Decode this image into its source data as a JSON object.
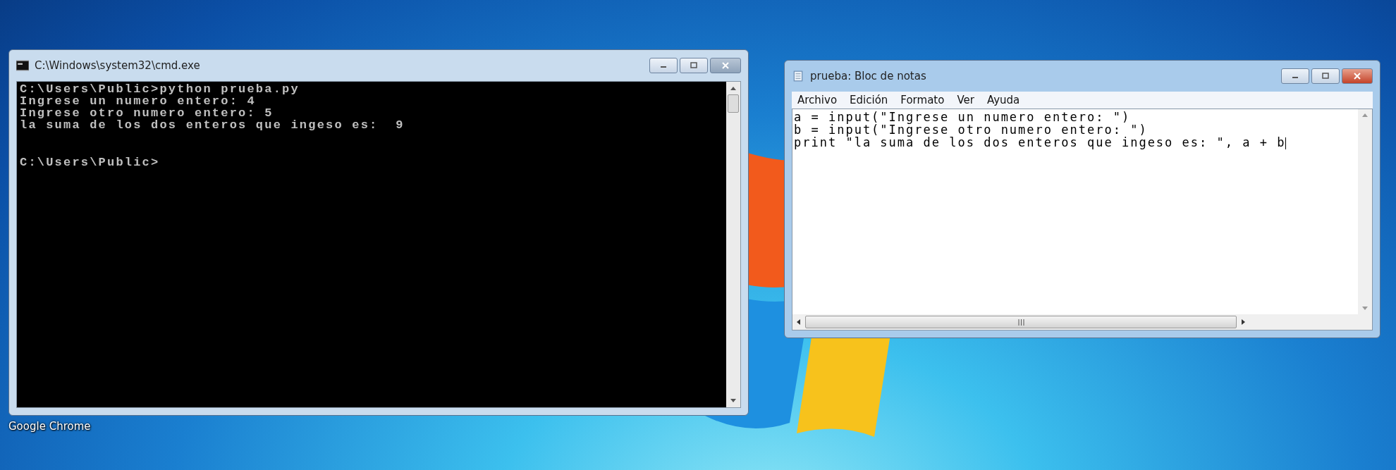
{
  "desktop": {
    "icons": [
      {
        "label": "Google Chrome"
      }
    ]
  },
  "console_window": {
    "title": "C:\\Windows\\system32\\cmd.exe",
    "active": false,
    "lines": [
      "C:\\Users\\Public>python prueba.py",
      "Ingrese un numero entero: 4",
      "Ingrese otro numero entero: 5",
      "la suma de los dos enteros que ingeso es:  9"
    ],
    "prompt": "C:\\Users\\Public>"
  },
  "notepad_window": {
    "title": "prueba: Bloc de notas",
    "active": true,
    "menu": [
      "Archivo",
      "Edición",
      "Formato",
      "Ver",
      "Ayuda"
    ],
    "lines": [
      "a = input(\"Ingrese un numero entero: \")",
      "b = input(\"Ingrese otro numero entero: \")",
      "print \"la suma de los dos enteros que ingeso es: \", a + b"
    ]
  }
}
